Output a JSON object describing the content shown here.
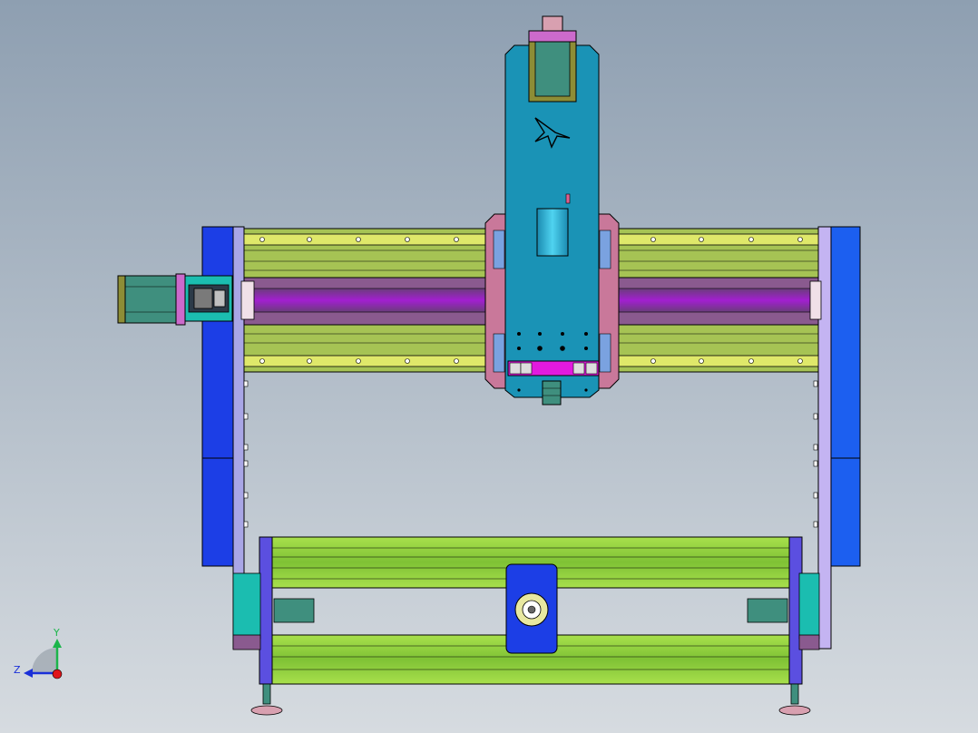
{
  "viewport": {
    "background_top": "#8e9fb1",
    "background_bottom": "#d6dbe0"
  },
  "triad": {
    "y_label": "Y",
    "z_label": "Z",
    "x_color": "#e0141a",
    "y_color": "#1bb54a",
    "z_color": "#1a2fd8"
  },
  "palette": {
    "rail_green": "#8fd33a",
    "rail_yellow": "#dfe86a",
    "rail_olive": "#a6c354",
    "side_blue": "#1c3ee6",
    "side_lavender": "#b8a8ec",
    "carriage_blue": "#1a93b6",
    "carriage_pink": "#c9789a",
    "motor_teal": "#3f8f7e",
    "screw_purple": "#8a1fb5",
    "accent_magenta": "#e21adf"
  }
}
